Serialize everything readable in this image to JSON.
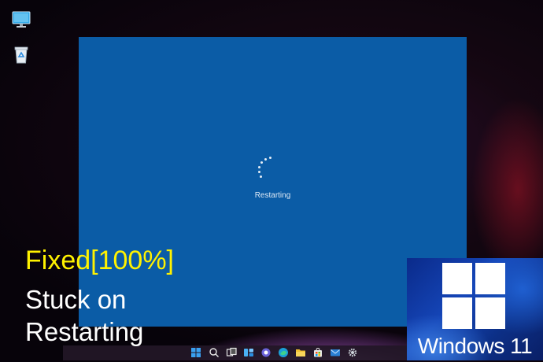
{
  "desktop": {
    "icons": [
      {
        "name": "This PC",
        "icon": "monitor-icon"
      },
      {
        "name": "Recycle Bin",
        "icon": "recycle-bin-icon"
      }
    ]
  },
  "restart_screen": {
    "status_text": "Restarting",
    "spinner_icon": "loading-dots-icon",
    "background_color": "#0b5ca6"
  },
  "caption": {
    "fixed": "Fixed[100%]",
    "line1": "Stuck on",
    "line2": "Restarting",
    "fixed_color": "#fff200"
  },
  "brand_tile": {
    "text": "Windows 11",
    "logo_icon": "windows-logo-icon"
  },
  "taskbar": {
    "icons": [
      "start-icon",
      "search-icon",
      "task-view-icon",
      "widgets-icon",
      "chat-icon",
      "edge-icon",
      "file-explorer-icon",
      "store-icon",
      "mail-icon",
      "settings-icon"
    ]
  }
}
